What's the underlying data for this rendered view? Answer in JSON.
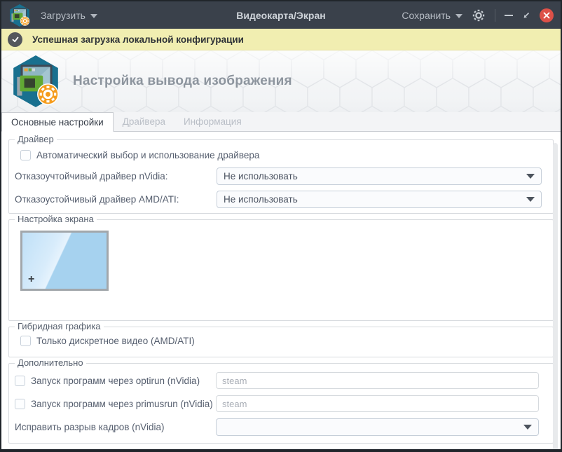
{
  "titlebar": {
    "load": "Загрузить",
    "title": "Видеокарта/Экран",
    "save": "Сохранить"
  },
  "notification": {
    "text": "Успешная загрузка локальной конфигурации"
  },
  "header": {
    "title": "Настройка вывода изображения"
  },
  "tabs": [
    {
      "label": "Основные настройки",
      "active": true
    },
    {
      "label": "Драйвера",
      "active": false
    },
    {
      "label": "Информация",
      "active": false
    }
  ],
  "driver_group": {
    "legend": "Драйвер",
    "auto_checkbox": "Автоматический выбор и использование драйвера",
    "nvidia_row": {
      "label": "Отказоучтойчивый драйвер nVidia:",
      "value": "Не использовать"
    },
    "amd_row": {
      "label": "Отказоустойчивый драйвер AMD/ATI:",
      "value": "Не использовать"
    }
  },
  "screen_group": {
    "legend": "Настройка экрана",
    "add_label": "+"
  },
  "hybrid_group": {
    "legend": "Гибридная графика",
    "discrete_checkbox": "Только дискретное видео (AMD/ATI)"
  },
  "extra_group": {
    "legend": "Дополнительно",
    "optirun": {
      "label": "Запуск программ через optirun (nVidia)",
      "placeholder": "steam",
      "value": ""
    },
    "primusrun": {
      "label": "Запуск программ через primusrun (nVidia)",
      "placeholder": "steam",
      "value": ""
    },
    "tearfix": {
      "label": "Исправить разрыв кадров (nVidia)",
      "value": ""
    }
  },
  "colors": {
    "titlebar_bg": "#3a414b",
    "notification_bg": "#f1eeb1",
    "close_button": "#dd5148",
    "screen_fill": "#a6d2ef",
    "accent_orange": "#f59c1d",
    "icon_hex_teal": "#19708f"
  }
}
